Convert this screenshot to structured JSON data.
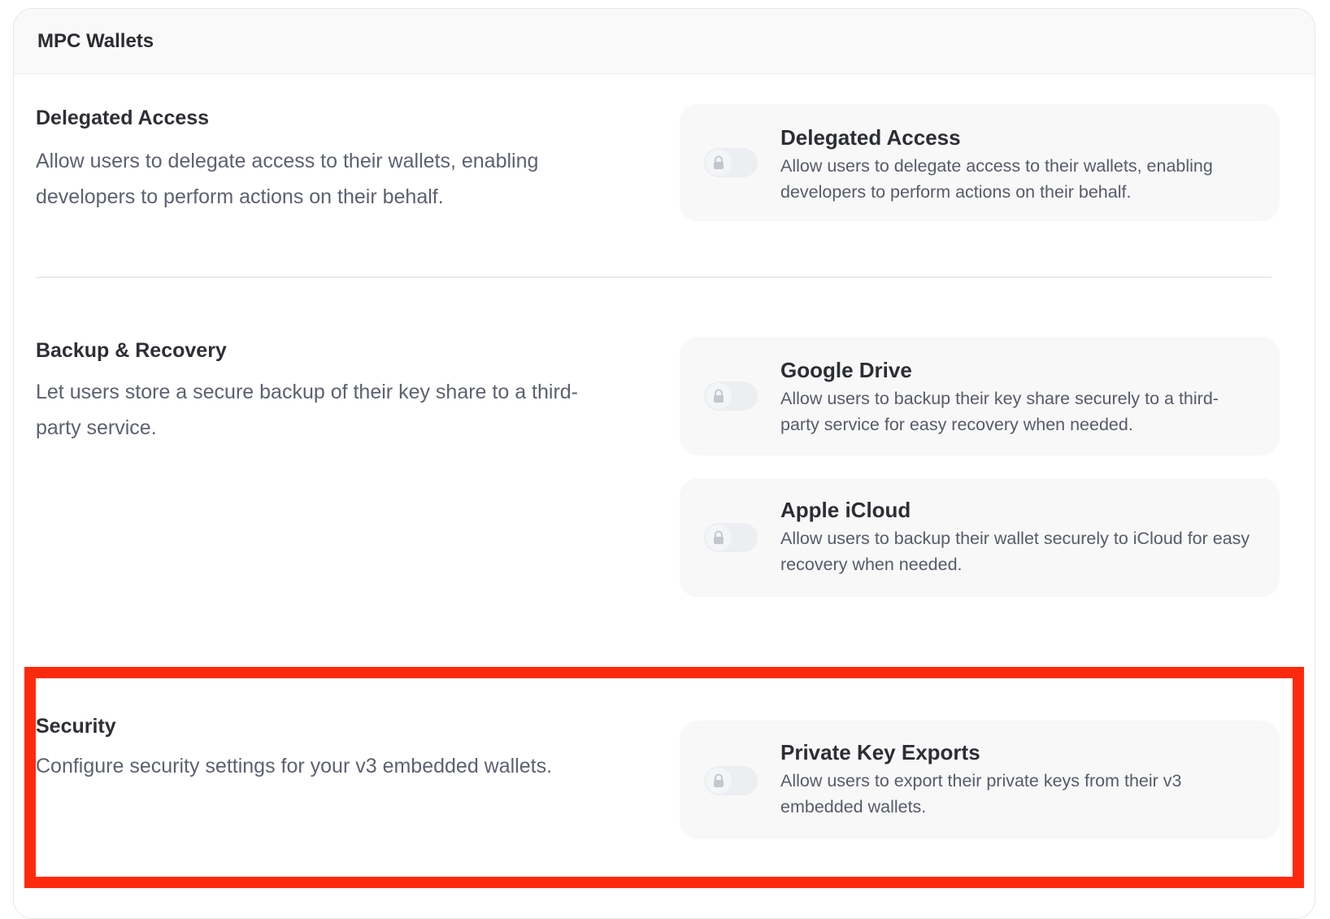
{
  "panel": {
    "title": "MPC Wallets"
  },
  "sections": {
    "delegated": {
      "title": "Delegated Access",
      "description": "Allow users to delegate access to their wallets, enabling developers to perform actions on their behalf.",
      "cards": {
        "delegated_access": {
          "title": "Delegated Access",
          "description": "Allow users to delegate access to their wallets, enabling developers to perform actions on their behalf.",
          "enabled": false,
          "locked": true
        }
      }
    },
    "backup": {
      "title": "Backup & Recovery",
      "description": "Let users store a secure backup of their key share to a third-party service.",
      "cards": {
        "google_drive": {
          "title": "Google Drive",
          "description": "Allow users to backup their key share securely to a third-party service for easy recovery when needed.",
          "enabled": false,
          "locked": true
        },
        "apple_icloud": {
          "title": "Apple iCloud",
          "description": "Allow users to backup their wallet securely to iCloud for easy recovery when needed.",
          "enabled": false,
          "locked": true
        }
      }
    },
    "security": {
      "title": "Security",
      "description": "Configure security settings for your v3 embedded wallets.",
      "cards": {
        "private_key_exports": {
          "title": "Private Key Exports",
          "description": "Allow users to export their private keys from their v3 embedded wallets.",
          "enabled": false,
          "locked": true
        }
      }
    }
  },
  "colors": {
    "highlight": "#ff2a0e",
    "card_background": "#f8f8f9",
    "toggle_track": "#eceef1",
    "lock_icon": "#c4c7cf"
  },
  "icons": {
    "toggle_lock": "lock-icon"
  }
}
